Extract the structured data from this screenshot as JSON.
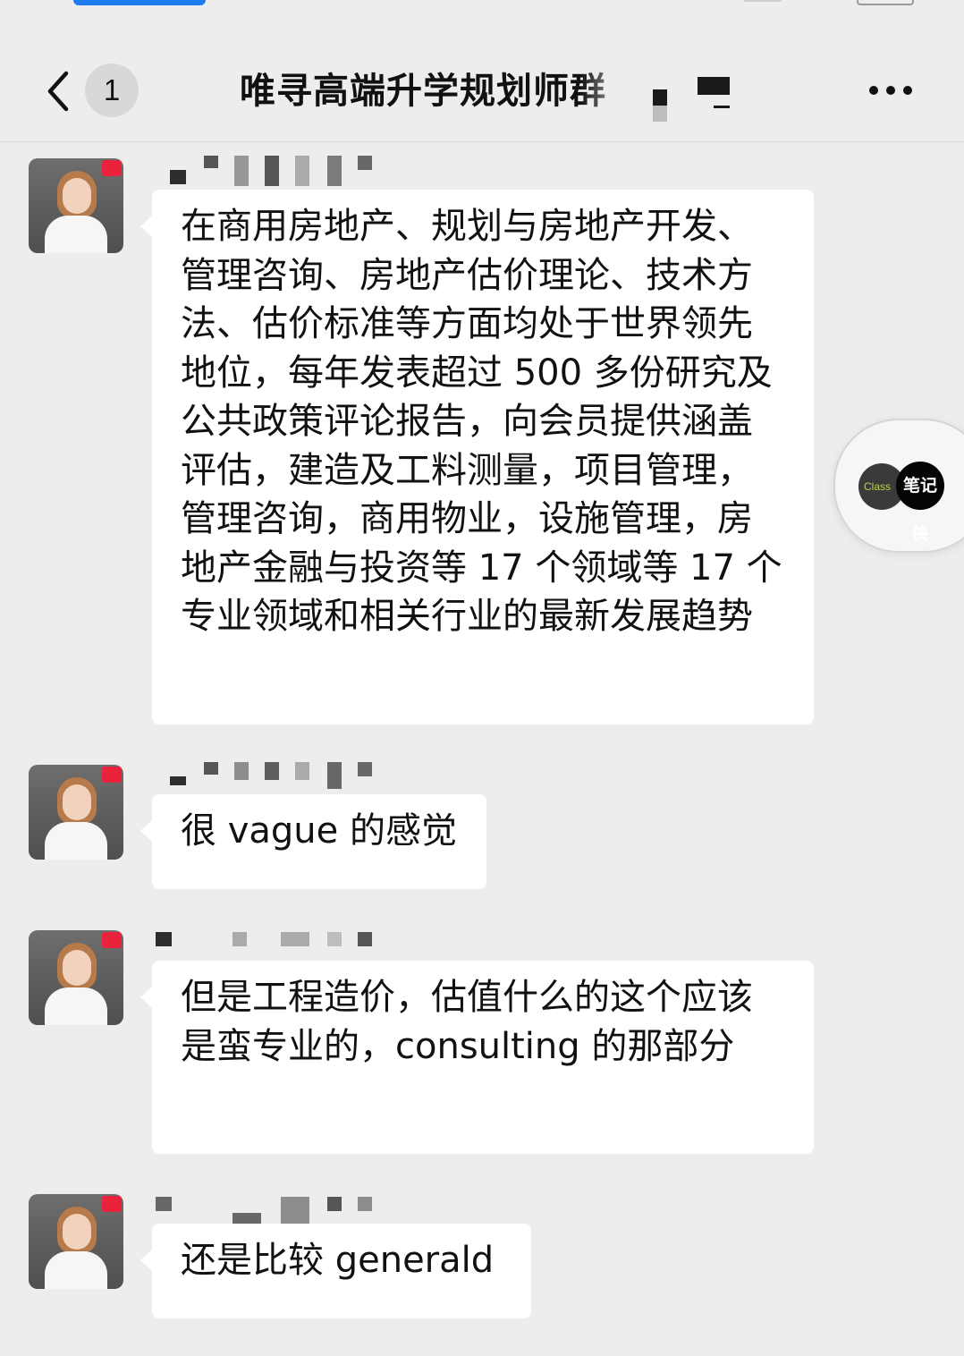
{
  "header": {
    "unread_count": "1",
    "title": "唯寻高端升学规划师群"
  },
  "floating_button": {
    "left_label": "Class",
    "right_label": "笔记侠"
  },
  "messages": [
    {
      "text": "在商用房地产、规划与房地产开发、管理咨询、房地产估价理论、技术方法、估价标准等方面均处于世界领先地位，每年发表超过 500 多份研究及公共政策评论报告，向会员提供涵盖评估，建造及工料测量，项目管理，管理咨询，商用物业，设施管理，房地产金融与投资等 17 个领域等 17 个专业领域和相关行业的最新发展趋势"
    },
    {
      "text": "很 vague 的感觉"
    },
    {
      "text": "但是工程造价，估值什么的这个应该是蛮专业的，consulting 的那部分"
    },
    {
      "text": "还是比较 generald"
    }
  ]
}
